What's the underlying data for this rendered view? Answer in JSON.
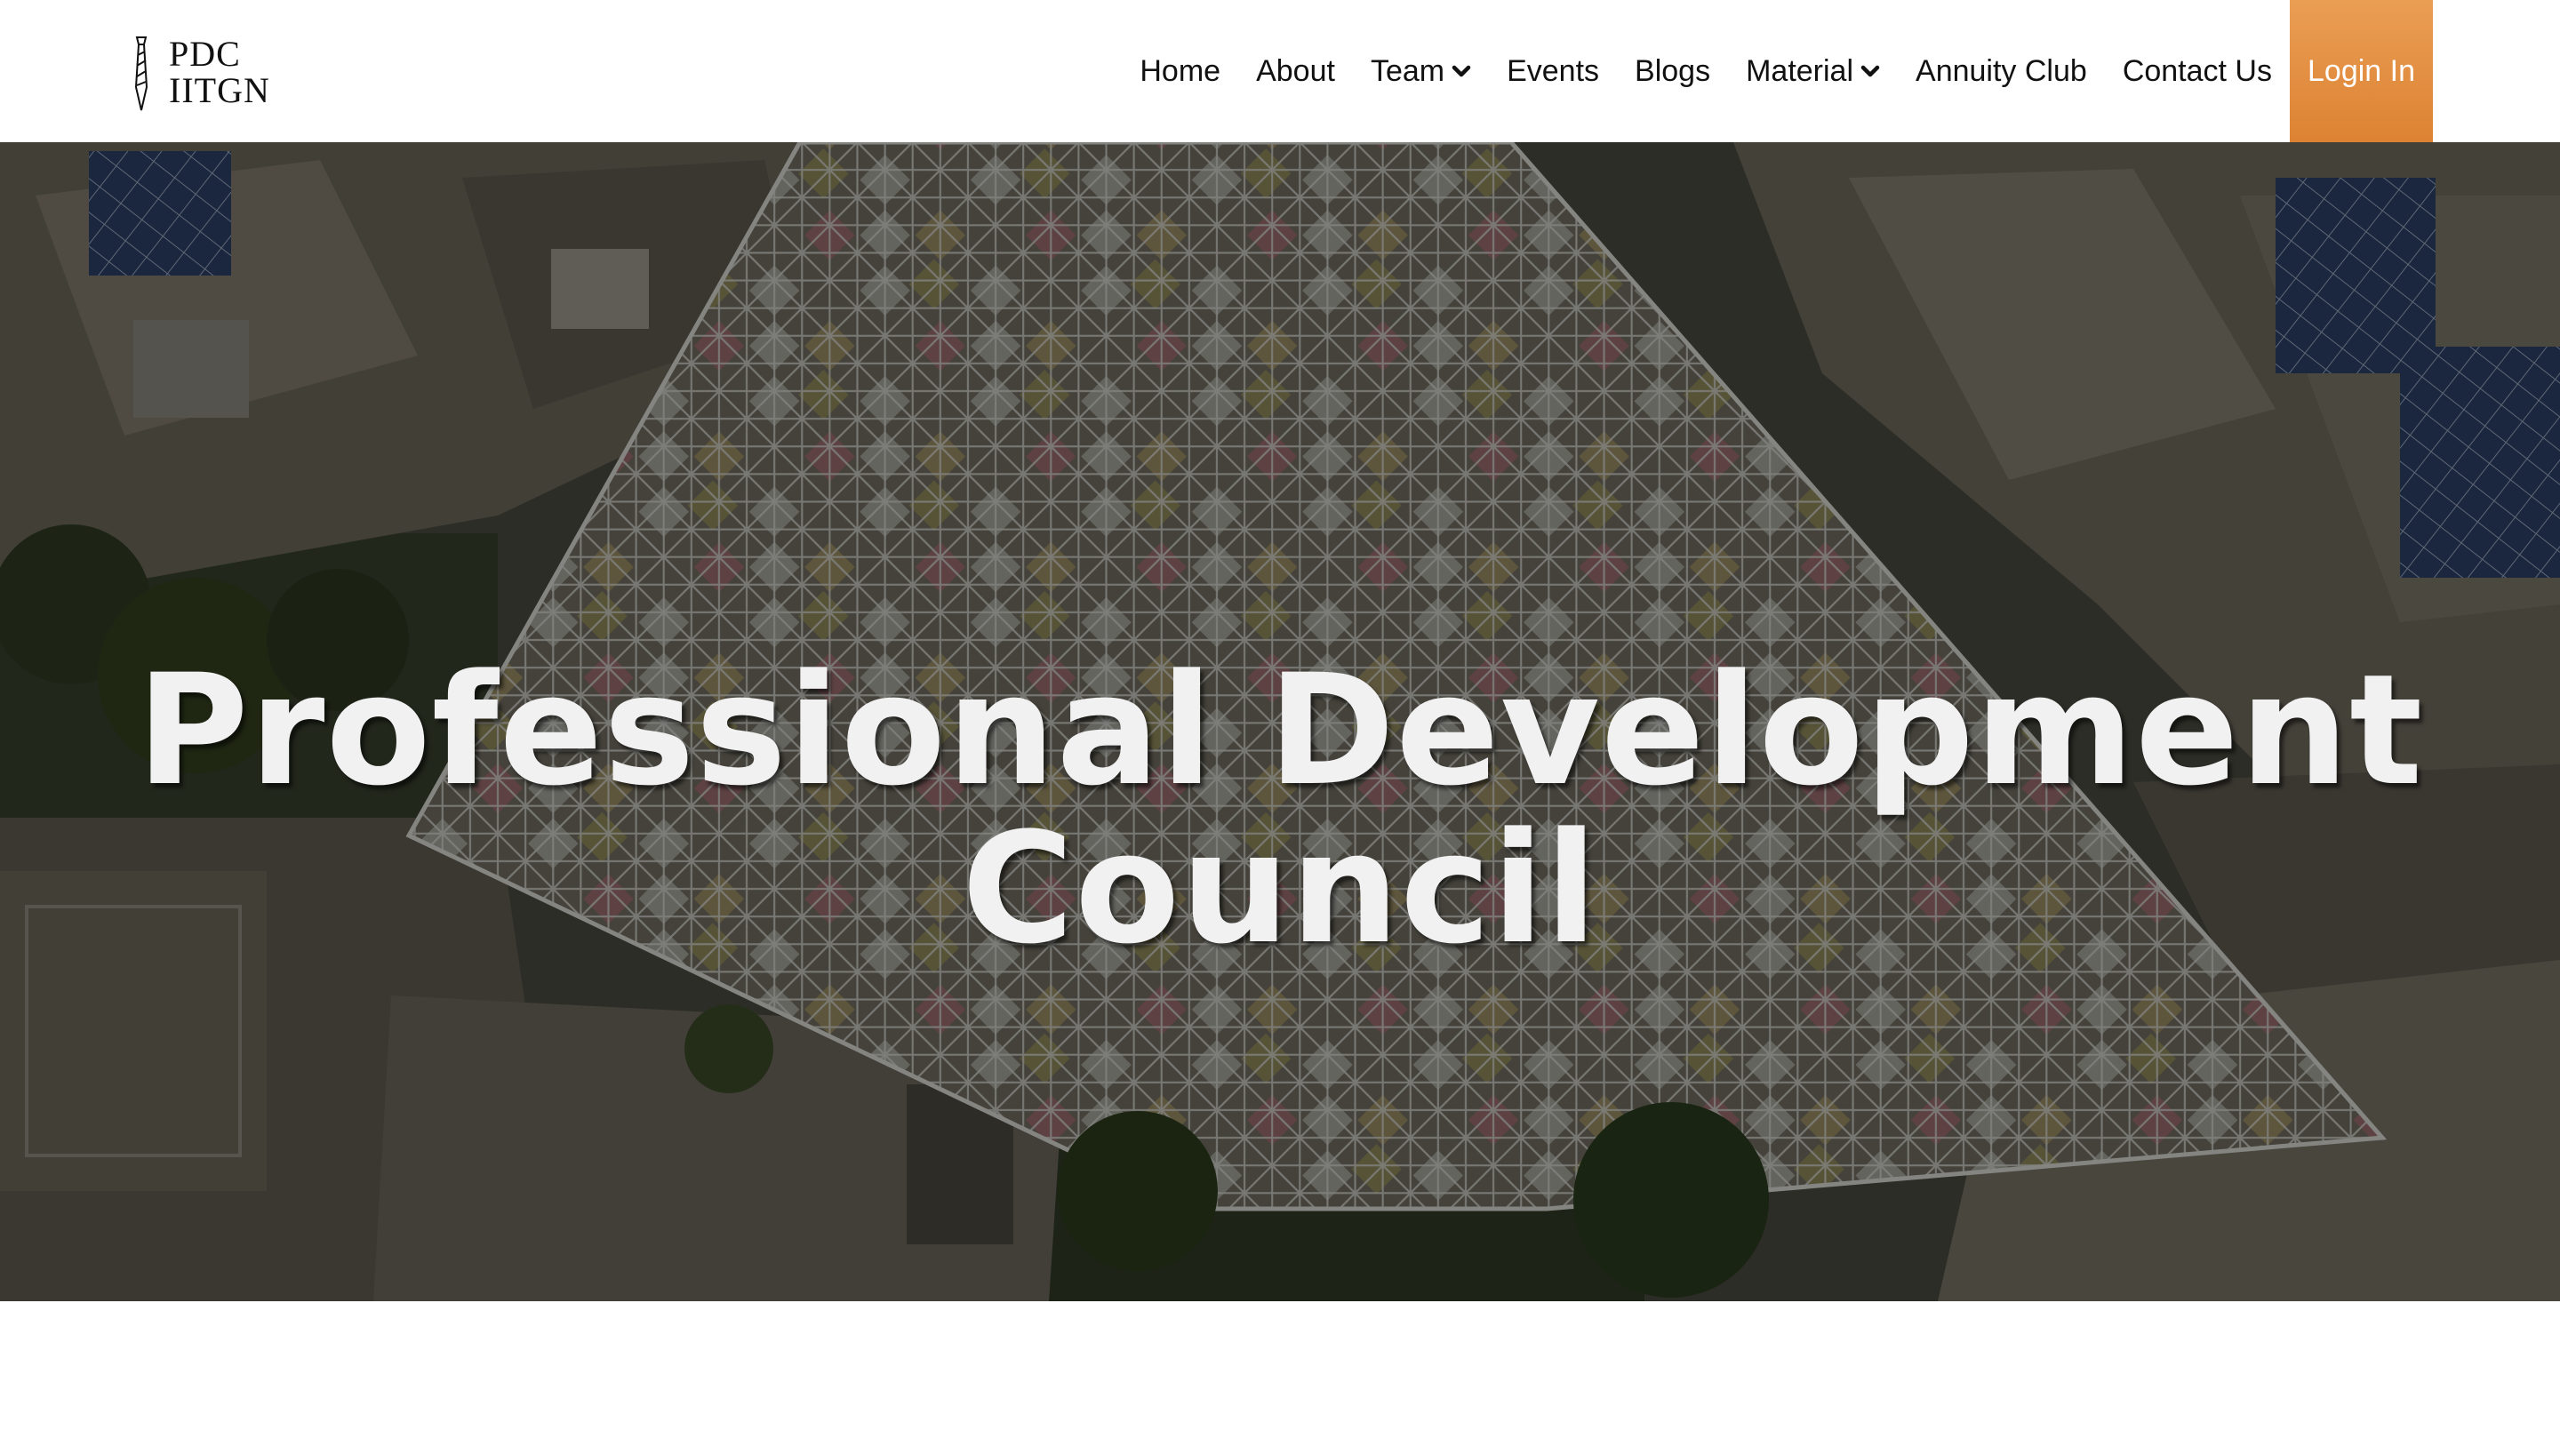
{
  "logo": {
    "line1": "PDC",
    "line2": "IITGN",
    "icon": "necktie-icon"
  },
  "nav": {
    "items": [
      {
        "label": "Home",
        "has_dropdown": false
      },
      {
        "label": "About",
        "has_dropdown": false
      },
      {
        "label": "Team",
        "has_dropdown": true
      },
      {
        "label": "Events",
        "has_dropdown": false
      },
      {
        "label": "Blogs",
        "has_dropdown": false
      },
      {
        "label": "Material",
        "has_dropdown": true
      },
      {
        "label": "Annuity Club",
        "has_dropdown": false
      },
      {
        "label": "Contact Us",
        "has_dropdown": false
      }
    ],
    "login_label": "Login In",
    "login_color": "#e08a3c"
  },
  "hero": {
    "title_line1": "Professional Development",
    "title_line2": "Council",
    "background": "aerial view of campus buildings with space-frame canopy"
  }
}
